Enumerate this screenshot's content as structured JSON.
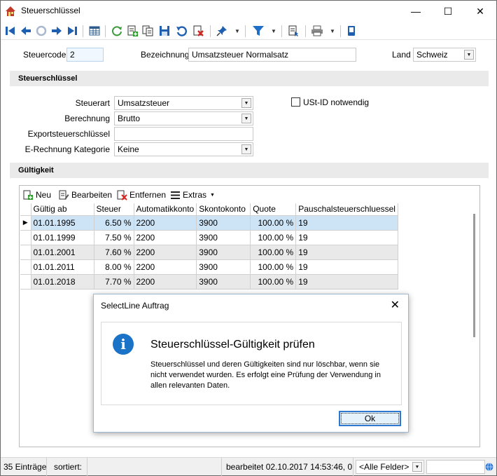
{
  "window": {
    "title": "Steuerschlüssel",
    "controls": {
      "minimize": "—",
      "maximize": "☐",
      "close": "✕"
    }
  },
  "toolbar": {
    "icons": [
      "first-record-icon",
      "prev-record-icon",
      "cancel-icon",
      "next-record-icon",
      "last-record-icon",
      "table-view-icon",
      "refresh-icon",
      "new-icon",
      "copy-icon",
      "save-icon",
      "undo-icon",
      "delete-icon",
      "pin-icon",
      "filter-icon",
      "report-icon",
      "print-icon",
      "extra-icon"
    ]
  },
  "header": {
    "steuercode_label": "Steuercode",
    "steuercode_value": "2",
    "bezeichnung_label": "Bezeichnung",
    "bezeichnung_value": "Umsatzsteuer Normalsatz",
    "land_label": "Land",
    "land_value": "Schweiz"
  },
  "section_steuerschluessel": {
    "title": "Steuerschlüssel",
    "steuerart_label": "Steuerart",
    "steuerart_value": "Umsatzsteuer",
    "berechnung_label": "Berechnung",
    "berechnung_value": "Brutto",
    "export_label": "Exportsteuerschlüssel",
    "export_value": "",
    "erechnung_label": "E-Rechnung Kategorie",
    "erechnung_value": "Keine",
    "ustid_label": "USt-ID notwendig",
    "ustid_checked": false
  },
  "section_gueltigkeit": {
    "title": "Gültigkeit",
    "toolbar": {
      "neu": "Neu",
      "bearbeiten": "Bearbeiten",
      "entfernen": "Entfernen",
      "extras": "Extras"
    },
    "columns": [
      "Gültig ab",
      "Steuer",
      "Automatikkonto",
      "Skontokonto",
      "Quote",
      "Pauschalsteuerschluessel"
    ],
    "rows": [
      [
        "01.01.1995",
        "6.50 %",
        "2200",
        "3900",
        "100.00 %",
        "19"
      ],
      [
        "01.01.1999",
        "7.50 %",
        "2200",
        "3900",
        "100.00 %",
        "19"
      ],
      [
        "01.01.2001",
        "7.60 %",
        "2200",
        "3900",
        "100.00 %",
        "19"
      ],
      [
        "01.01.2011",
        "8.00 %",
        "2200",
        "3900",
        "100.00 %",
        "19"
      ],
      [
        "01.01.2018",
        "7.70 %",
        "2200",
        "3900",
        "100.00 %",
        "19"
      ]
    ],
    "selected_row": 0,
    "row_indicator": "▶"
  },
  "statusbar": {
    "count": "35 Einträge",
    "sortiert": "sortiert:",
    "sort_value": "",
    "bearbeitet": "bearbeitet 02.10.2017 14:53:46,  0",
    "filter_field": "<Alle Felder>",
    "search_value": ""
  },
  "dialog": {
    "title": "SelectLine Auftrag",
    "close": "✕",
    "heading": "Steuerschlüssel-Gültigkeit prüfen",
    "body": "Steuerschlüssel und deren Gültigkeiten sind nur löschbar, wenn sie nicht verwendet wurden. Es erfolgt eine Prüfung der Verwendung in allen relevanten Daten.",
    "ok_label": "Ok",
    "info_glyph": "i"
  },
  "colors": {
    "accent_blue": "#1b73c7",
    "selected_row": "#cde4f7",
    "alt_row": "#e9e9e9",
    "section_bar": "#eaeaea"
  }
}
